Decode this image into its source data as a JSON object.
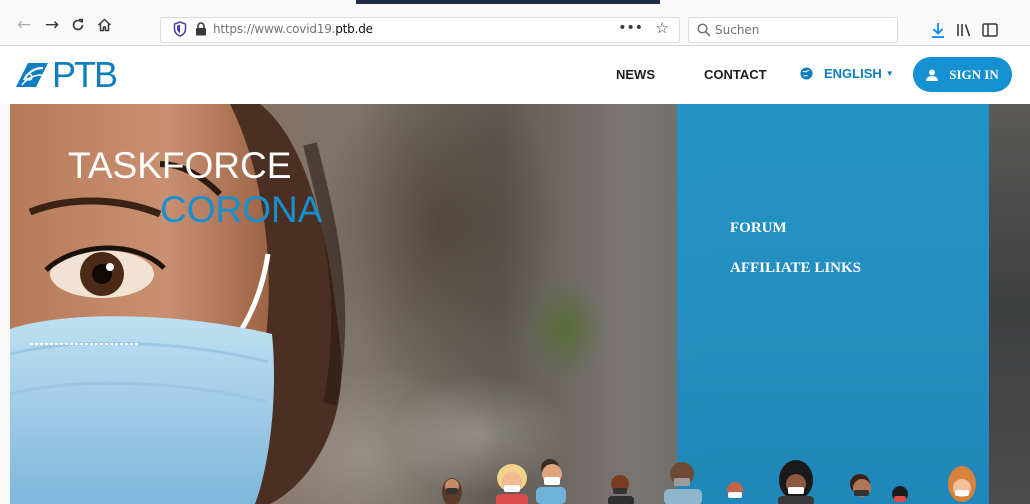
{
  "browser": {
    "url_prefix": "https://www.covid19.",
    "url_domain": "ptb.de",
    "url_more": "•••",
    "search_placeholder": "Suchen"
  },
  "site": {
    "logo_text": "PTB",
    "nav": {
      "news": "NEWS",
      "contact": "CONTACT",
      "language": "ENGLISH",
      "sign_in": "SIGN IN"
    }
  },
  "hero": {
    "title_line1": "TASKFORCE",
    "title_line2": "CORONA",
    "title_color1": "#ffffff",
    "title_color2": "#1590d0",
    "panel_links": [
      "FORUM",
      "AFFILIATE LINKS"
    ]
  },
  "colors": {
    "brand_blue": "#1590d0",
    "panel_blue": "#1e95c9"
  }
}
